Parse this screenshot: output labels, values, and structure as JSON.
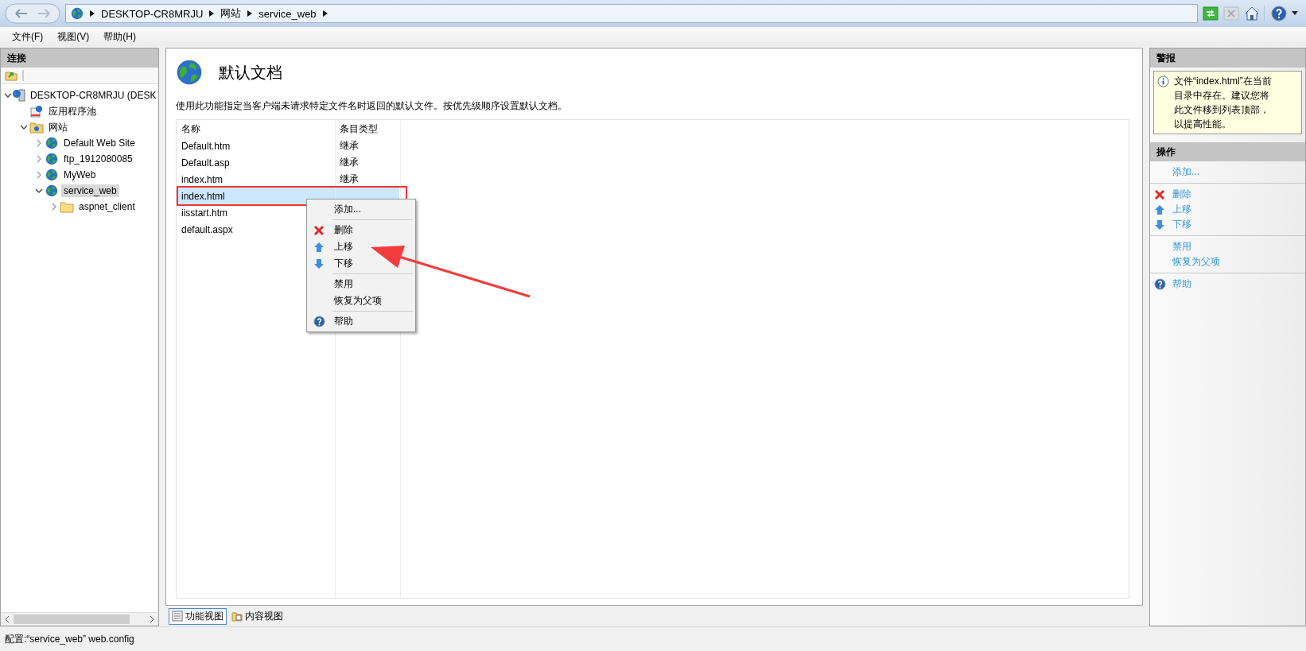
{
  "address_bar": {
    "crumbs": [
      "DESKTOP-CR8MRJU",
      "网站",
      "service_web"
    ]
  },
  "menu_bar": [
    "文件(F)",
    "视图(V)",
    "帮助(H)"
  ],
  "connections": {
    "title": "连接",
    "tree": [
      {
        "label": "DESKTOP-CR8MRJU (DESK",
        "kind": "server",
        "expanded": true,
        "selected": false,
        "children": [
          {
            "label": "应用程序池",
            "kind": "pool",
            "selected": false
          },
          {
            "label": "网站",
            "kind": "sites",
            "expanded": true,
            "selected": false,
            "children": [
              {
                "label": "Default Web Site",
                "kind": "site",
                "expanded": false,
                "selected": false
              },
              {
                "label": "ftp_1912080085",
                "kind": "site",
                "expanded": false,
                "selected": false
              },
              {
                "label": "MyWeb",
                "kind": "site",
                "expanded": false,
                "selected": false
              },
              {
                "label": "service_web",
                "kind": "site",
                "expanded": true,
                "selected": true,
                "children": [
                  {
                    "label": "aspnet_client",
                    "kind": "folder",
                    "expanded": false,
                    "selected": false
                  }
                ]
              }
            ]
          }
        ]
      }
    ]
  },
  "feature": {
    "title": "默认文档",
    "description": "使用此功能指定当客户端未请求特定文件名时返回的默认文件。按优先级顺序设置默认文档。",
    "table": {
      "columns": [
        "名称",
        "条目类型"
      ],
      "rows": [
        {
          "name": "Default.htm",
          "type": "继承",
          "selected": false
        },
        {
          "name": "Default.asp",
          "type": "继承",
          "selected": false
        },
        {
          "name": "index.htm",
          "type": "继承",
          "selected": false
        },
        {
          "name": "index.html",
          "selected": true
        },
        {
          "name": "iisstart.htm",
          "selected": false
        },
        {
          "name": "default.aspx",
          "selected": false
        }
      ]
    },
    "context_menu": [
      [
        {
          "label": "添加...",
          "kind": "plain"
        }
      ],
      [
        {
          "label": "删除",
          "kind": "delete"
        },
        {
          "label": "上移",
          "kind": "up"
        },
        {
          "label": "下移",
          "kind": "down"
        }
      ],
      [
        {
          "label": "禁用",
          "kind": "plain"
        },
        {
          "label": "恢复为父项",
          "kind": "plain"
        }
      ],
      [
        {
          "label": "帮助",
          "kind": "help"
        }
      ]
    ]
  },
  "view_tabs": [
    {
      "label": "功能视图",
      "selected": true
    },
    {
      "label": "内容视图",
      "selected": false
    }
  ],
  "alerts": {
    "title": "警报",
    "message": "文件“index.html”在当前目录中存在。建议您将此文件移到列表顶部，以提高性能。"
  },
  "actions": {
    "title": "操作",
    "groups": [
      [
        {
          "label": "添加...",
          "kind": "plain"
        }
      ],
      [
        {
          "label": "删除",
          "kind": "delete"
        },
        {
          "label": "上移",
          "kind": "up"
        },
        {
          "label": "下移",
          "kind": "down"
        }
      ],
      [
        {
          "label": "禁用",
          "kind": "plain"
        },
        {
          "label": "恢复为父项",
          "kind": "plain"
        }
      ],
      [
        {
          "label": "帮助",
          "kind": "help"
        }
      ]
    ]
  },
  "status_bar": {
    "text": "配置:“service_web” web.config"
  }
}
